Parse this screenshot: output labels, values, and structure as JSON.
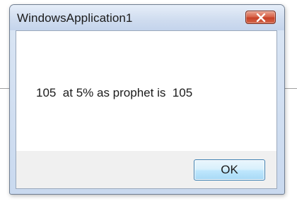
{
  "window": {
    "title": "WindowsApplication1"
  },
  "message": {
    "text": "105  at 5% as prophet is  105"
  },
  "buttons": {
    "ok_label": "OK"
  },
  "icons": {
    "close": "close-icon"
  },
  "colors": {
    "close_button": "#c74128",
    "ok_button_border": "#3c7fb1",
    "button_area": "#f0f0f0"
  }
}
